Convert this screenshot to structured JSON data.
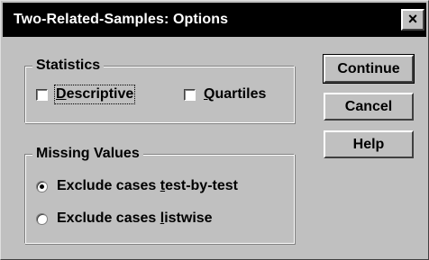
{
  "window": {
    "title": "Two-Related-Samples: Options",
    "close_glyph": "×"
  },
  "statistics": {
    "label": "Statistics",
    "descriptive": {
      "pre": "",
      "mnemonic": "D",
      "post": "escriptive",
      "checked": false
    },
    "quartiles": {
      "pre": "",
      "mnemonic": "Q",
      "post": "uartiles",
      "checked": false
    }
  },
  "missing_values": {
    "label": "Missing Values",
    "test_by_test": {
      "pre": "Exclude cases ",
      "mnemonic": "t",
      "post": "est-by-test",
      "selected": true
    },
    "listwise": {
      "pre": "Exclude cases ",
      "mnemonic": "l",
      "post": "istwise",
      "selected": false
    }
  },
  "buttons": {
    "continue": "Continue",
    "cancel": "Cancel",
    "help": "Help"
  }
}
